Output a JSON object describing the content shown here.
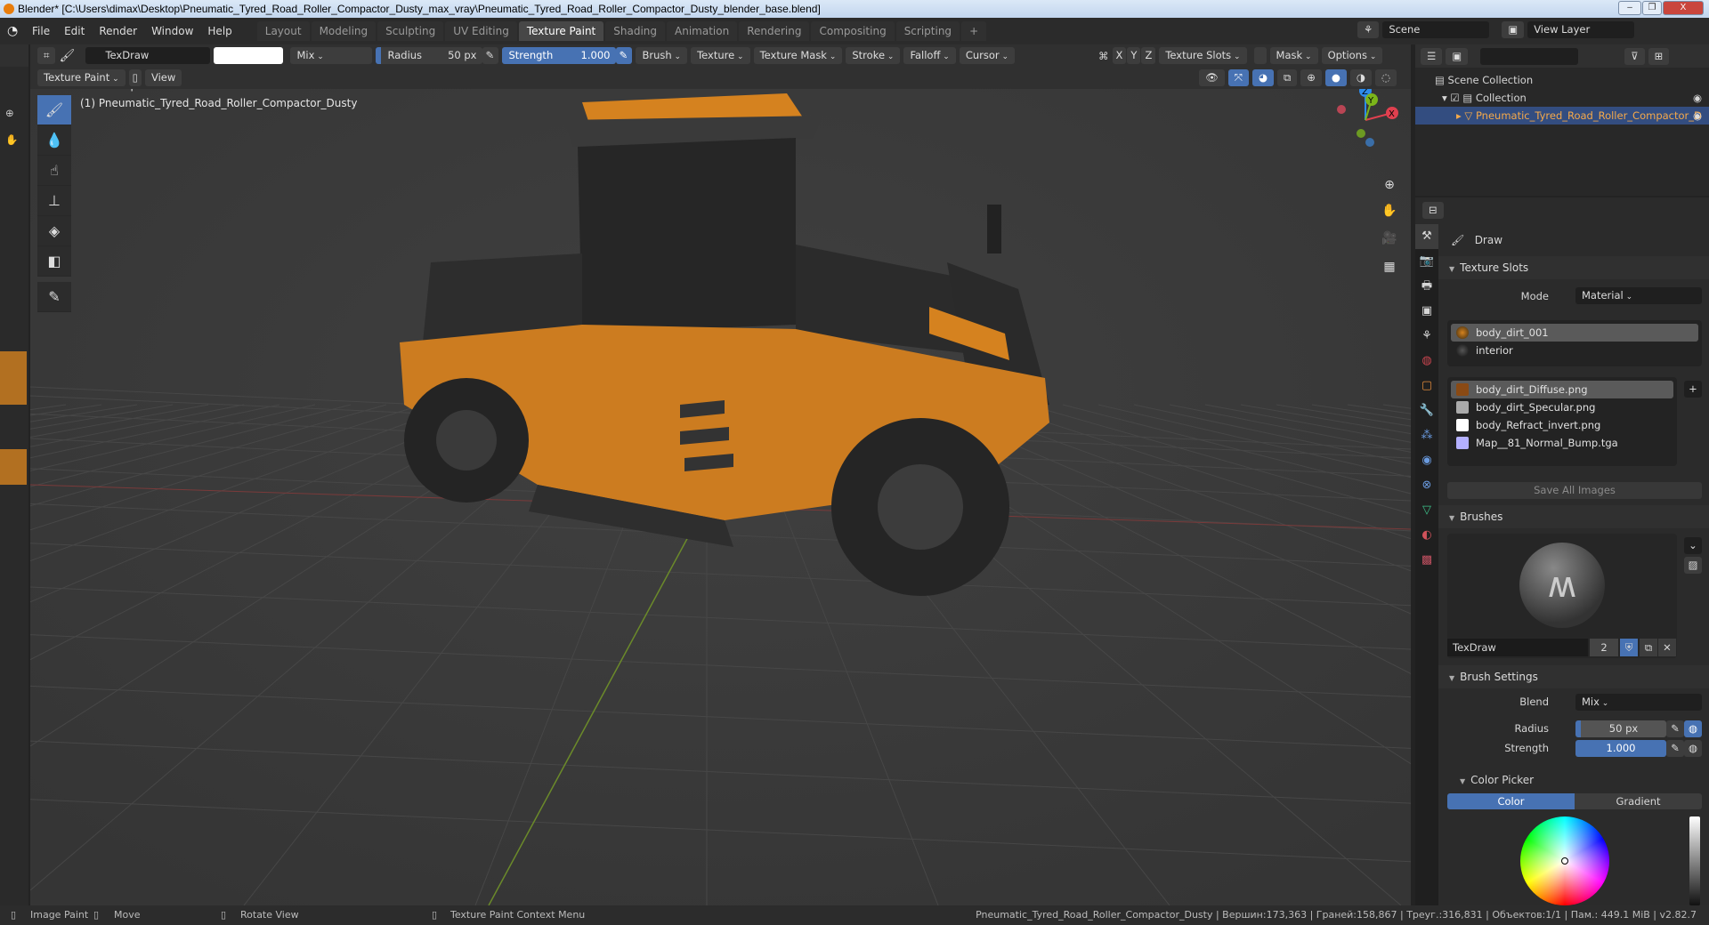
{
  "window": {
    "title": "Blender* [C:\\Users\\dimax\\Desktop\\Pneumatic_Tyred_Road_Roller_Compactor_Dusty_max_vray\\Pneumatic_Tyred_Road_Roller_Compactor_Dusty_blender_base.blend]",
    "minimize": "–",
    "maximize": "❐",
    "close": "X"
  },
  "menu": [
    "File",
    "Edit",
    "Render",
    "Window",
    "Help"
  ],
  "workspaces": [
    {
      "label": "Layout"
    },
    {
      "label": "Modeling"
    },
    {
      "label": "Sculpting"
    },
    {
      "label": "UV Editing"
    },
    {
      "label": "Texture Paint",
      "active": true
    },
    {
      "label": "Shading"
    },
    {
      "label": "Animation"
    },
    {
      "label": "Rendering"
    },
    {
      "label": "Compositing"
    },
    {
      "label": "Scripting"
    }
  ],
  "add_workspace": "+",
  "scene": {
    "label": "Scene",
    "view_layer": "View Layer"
  },
  "toolheader": {
    "brush_name": "TexDraw",
    "color": "#ffffff",
    "blend": "Mix",
    "radius_label": "Radius",
    "radius_value": "50 px",
    "strength_label": "Strength",
    "strength_value": "1.000",
    "strength_fraction": 1.0,
    "menus": [
      "Brush",
      "Texture",
      "Texture Mask",
      "Stroke",
      "Falloff",
      "Cursor"
    ],
    "axes": [
      "X",
      "Y",
      "Z"
    ],
    "right_menus": [
      "Texture Slots",
      "Mask",
      "Options"
    ]
  },
  "header2": {
    "mode": "Texture Paint",
    "view": "View"
  },
  "viewport": {
    "perspective": "User Perspective",
    "object": "(1) Pneumatic_Tyred_Road_Roller_Compactor_Dusty",
    "gizmo": {
      "x": "X",
      "y": "Y",
      "z": "Z"
    },
    "colors": {
      "body": "#d5821f",
      "x_axis": "#e0404f",
      "y_axis": "#7bb51a",
      "z_axis": "#2d8ceb"
    }
  },
  "tools": [
    "paint-brush",
    "soften",
    "smear",
    "clone",
    "fill",
    "mask",
    "annotate"
  ],
  "outliner": {
    "search_placeholder": "",
    "scene_collection": "Scene Collection",
    "collection": "Collection",
    "object": "Pneumatic_Tyred_Road_Roller_Compactor_D"
  },
  "properties": {
    "tool_name": "Draw",
    "texture_slots": {
      "title": "Texture Slots",
      "mode_label": "Mode",
      "mode_value": "Material",
      "materials": [
        {
          "name": "body_dirt_001",
          "selected": true
        },
        {
          "name": "interior"
        }
      ],
      "images": [
        {
          "name": "body_dirt_Diffuse.png",
          "selected": true
        },
        {
          "name": "body_dirt_Specular.png"
        },
        {
          "name": "body_Refract_invert.png"
        },
        {
          "name": "Map__81_Normal_Bump.tga"
        }
      ],
      "add": "+",
      "save_all": "Save All Images"
    },
    "brushes": {
      "title": "Brushes",
      "name": "TexDraw",
      "users": "2"
    },
    "brush_settings": {
      "title": "Brush Settings",
      "blend_label": "Blend",
      "blend_value": "Mix",
      "radius_label": "Radius",
      "radius_value": "50 px",
      "strength_label": "Strength",
      "strength_value": "1.000"
    },
    "color_picker": {
      "title": "Color Picker",
      "tabs": [
        "Color",
        "Gradient"
      ],
      "active_tab": "Color",
      "value": 1.0
    }
  },
  "status": {
    "left": [
      {
        "label": "Image Paint"
      },
      {
        "label": "Move"
      },
      {
        "label": "Rotate View"
      },
      {
        "label": "Texture Paint Context Menu"
      }
    ],
    "right": "Pneumatic_Tyred_Road_Roller_Compactor_Dusty | Вершин:173,363 | Граней:158,867 | Треуг.:316,831 | Объектов:1/1 | Пам.: 449.1 MiB | v2.82.7"
  }
}
